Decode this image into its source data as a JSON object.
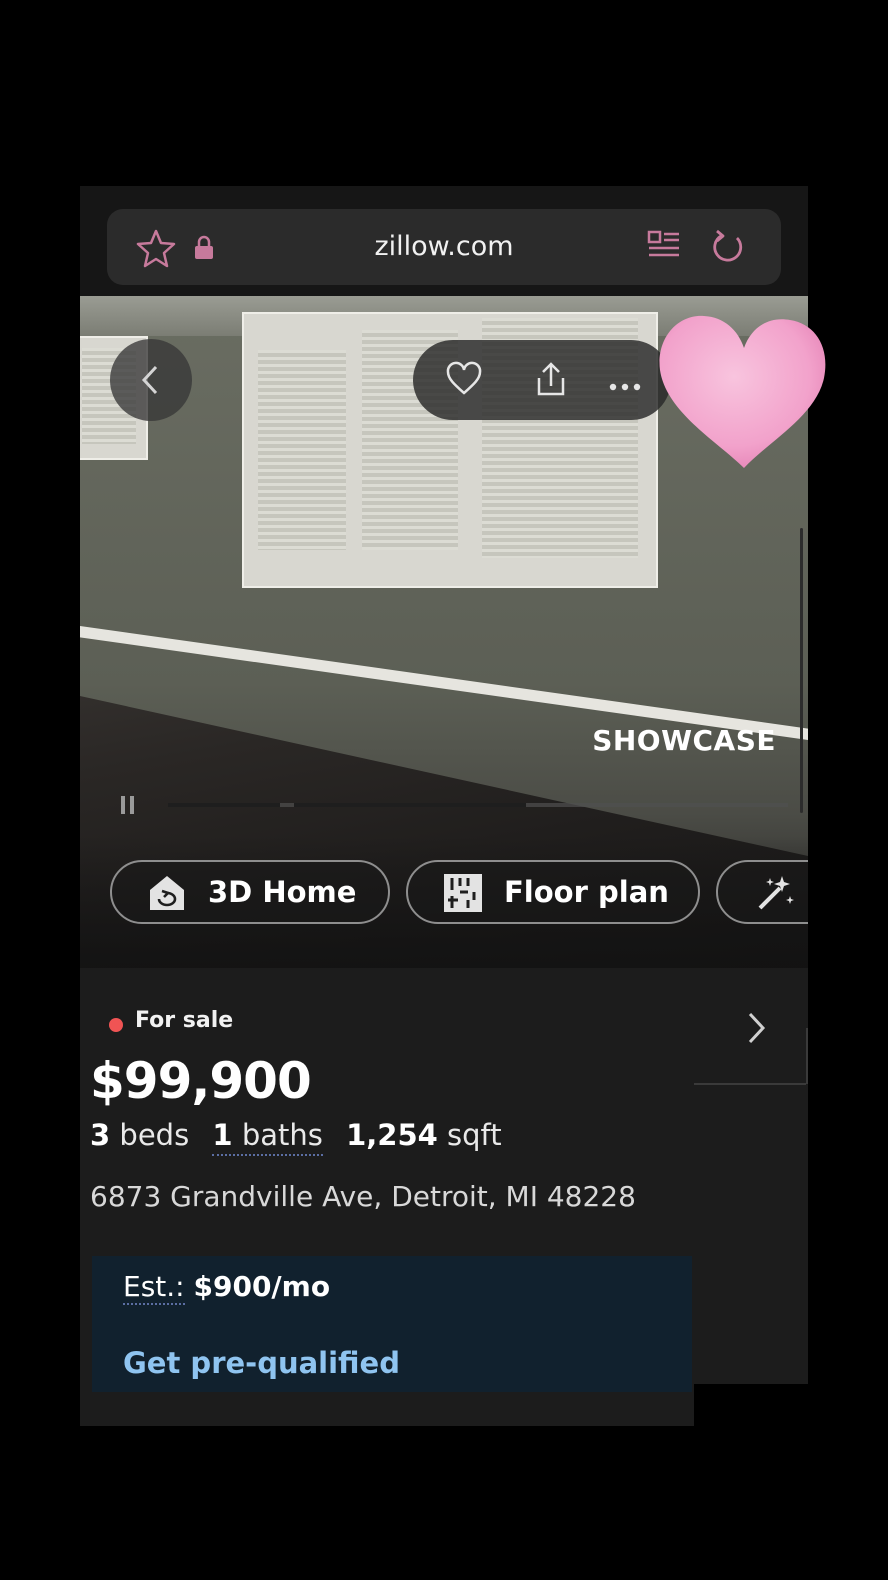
{
  "browser": {
    "url": "zillow.com"
  },
  "photo": {
    "showcase_label": "SHOWCASE",
    "chips": [
      {
        "label": "3D Home",
        "icon": "3d-home-icon"
      },
      {
        "label": "Floor plan",
        "icon": "floor-plan-icon"
      },
      {
        "label": "",
        "icon": "magic-wand-icon"
      }
    ]
  },
  "listing": {
    "status": "For sale",
    "price": "$99,900",
    "beds_count": "3",
    "beds_label": "beds",
    "baths_count": "1",
    "baths_label": "baths",
    "sqft_count": "1,254",
    "sqft_label": "sqft",
    "address": "6873 Grandville Ave, Detroit, MI 48228"
  },
  "payment": {
    "est_label": "Est.:",
    "est_value": "$900/mo",
    "cta": "Get pre-qualified"
  },
  "colors": {
    "status_dot": "#f05454",
    "cta_link": "#8fc4f0",
    "sticker": "#f3a6cf"
  }
}
